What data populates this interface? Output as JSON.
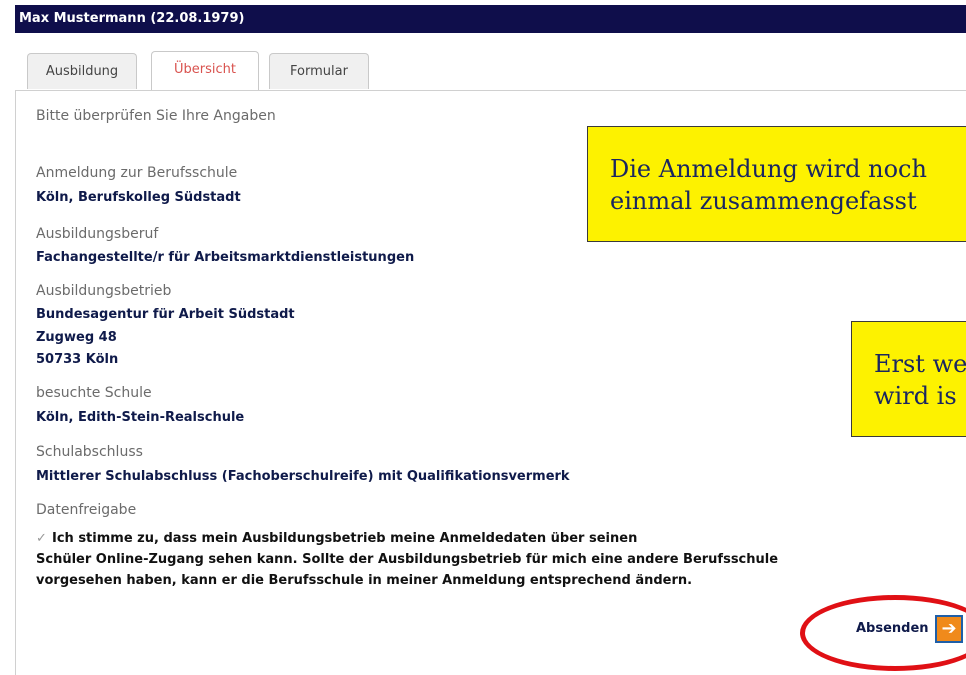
{
  "header": {
    "title": "Max Mustermann (22.08.1979)"
  },
  "tabs": [
    {
      "label": "Ausbildung",
      "active": false
    },
    {
      "label": "Übersicht",
      "active": true
    },
    {
      "label": "Formular",
      "active": false
    }
  ],
  "main": {
    "intro": "Bitte überprüfen Sie Ihre Angaben",
    "sections": [
      {
        "label": "Anmeldung zur Berufsschule",
        "values": [
          "Köln, Berufskolleg Südstadt"
        ]
      },
      {
        "label": "Ausbildungsberuf",
        "values": [
          "Fachangestellte/r für Arbeitsmarktdienstleistungen"
        ]
      },
      {
        "label": "Ausbildungsbetrieb",
        "values": [
          "Bundesagentur für Arbeit Südstadt",
          "Zugweg 48",
          "50733 Köln"
        ]
      },
      {
        "label": "besuchte Schule",
        "values": [
          "Köln, Edith-Stein-Realschule"
        ]
      },
      {
        "label": "Schulabschluss",
        "values": [
          "Mittlerer Schulabschluss (Fachoberschulreife) mit Qualifikationsvermerk"
        ]
      }
    ],
    "consent": {
      "label": "Datenfreigabe",
      "lines": [
        "Ich stimme zu, dass mein Ausbildungsbetrieb meine Anmeldedaten über seinen",
        "Schüler Online-Zugang sehen kann. Sollte der Ausbildungsbetrieb für mich eine andere Berufsschule",
        "vorgesehen haben, kann er die Berufsschule in meiner Anmeldung entsprechend ändern."
      ],
      "checked": true
    },
    "submit_label": "Absenden"
  },
  "callouts": [
    {
      "lines": [
        "Die Anmeldung wird noch",
        "einmal zusammengefasst"
      ]
    },
    {
      "lines": [
        "Erst we",
        "wird is"
      ]
    }
  ],
  "colors": {
    "titlebar": "#0f0e4b",
    "callout": "#fdf200",
    "highlight": "#e01015",
    "active_tab": "#d9534f"
  }
}
